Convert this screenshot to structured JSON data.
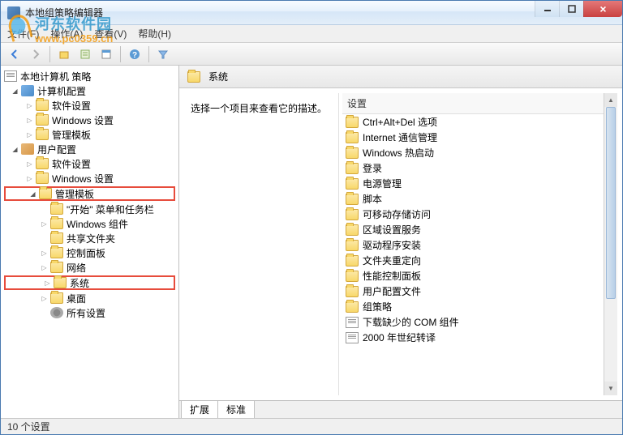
{
  "window": {
    "title": "本地组策略编辑器"
  },
  "watermark": {
    "text1": "河东软件园",
    "text2": "www.pc0359.cn"
  },
  "menubar": {
    "file": "文件(F)",
    "action": "操作(A)",
    "view": "查看(V)",
    "help": "帮助(H)"
  },
  "tree": {
    "root": "本地计算机 策略",
    "computer_config": "计算机配置",
    "cc_software": "软件设置",
    "cc_windows": "Windows 设置",
    "cc_admin": "管理模板",
    "user_config": "用户配置",
    "uc_software": "软件设置",
    "uc_windows": "Windows 设置",
    "uc_admin": "管理模板",
    "start_menu": "\"开始\" 菜单和任务栏",
    "win_components": "Windows 组件",
    "shared_folders": "共享文件夹",
    "control_panel": "控制面板",
    "network": "网络",
    "system": "系统",
    "desktop": "桌面",
    "all_settings": "所有设置"
  },
  "right": {
    "header": "系统",
    "description": "选择一个项目来查看它的描述。",
    "list_header": "设置",
    "items": [
      {
        "type": "folder",
        "label": "Ctrl+Alt+Del 选项"
      },
      {
        "type": "folder",
        "label": "Internet 通信管理"
      },
      {
        "type": "folder",
        "label": "Windows 热启动"
      },
      {
        "type": "folder",
        "label": "登录"
      },
      {
        "type": "folder",
        "label": "电源管理"
      },
      {
        "type": "folder",
        "label": "脚本"
      },
      {
        "type": "folder",
        "label": "可移动存储访问"
      },
      {
        "type": "folder",
        "label": "区域设置服务"
      },
      {
        "type": "folder",
        "label": "驱动程序安装"
      },
      {
        "type": "folder",
        "label": "文件夹重定向"
      },
      {
        "type": "folder",
        "label": "性能控制面板"
      },
      {
        "type": "folder",
        "label": "用户配置文件"
      },
      {
        "type": "folder",
        "label": "组策略"
      },
      {
        "type": "doc",
        "label": "下载缺少的 COM 组件"
      },
      {
        "type": "doc",
        "label": "2000 年世纪转译"
      }
    ]
  },
  "tabs": {
    "extended": "扩展",
    "standard": "标准"
  },
  "statusbar": {
    "text": "10 个设置"
  }
}
